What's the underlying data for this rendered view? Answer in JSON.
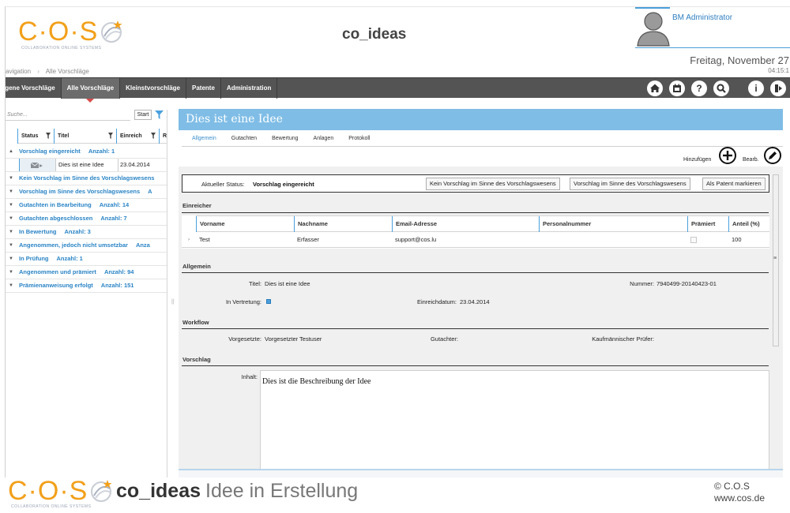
{
  "header": {
    "logo_text": "C·O·S",
    "logo_subtitle": "COLLABORATION ONLINE SYSTEMS",
    "app_title": "co_ideas",
    "user_name": "BM Administrator",
    "date": "Freitag, November 27",
    "time": "04:15:1",
    "breadcrumb": [
      "avigation",
      "Alle Vorschläge"
    ]
  },
  "nav": {
    "tabs": [
      {
        "label": "igene Vorschläge",
        "active": false
      },
      {
        "label": "Alle Vorschläge",
        "active": true
      },
      {
        "label": "Kleinstvorschläge",
        "active": false
      },
      {
        "label": "Patente",
        "active": false
      },
      {
        "label": "Administration",
        "active": false
      }
    ],
    "icons": [
      "home-icon",
      "calendar-icon",
      "help-icon",
      "search-icon",
      "info-icon",
      "logout-icon"
    ]
  },
  "left": {
    "search_placeholder": "Suche...",
    "start_label": "Start",
    "columns": [
      "Status",
      "Titel",
      "Einreich",
      "R"
    ],
    "groups": [
      {
        "label": "Vorschlag eingereicht",
        "count_label": "Anzahl: 1",
        "expanded": true,
        "items": [
          {
            "title": "Dies ist eine Idee",
            "date": "23.04.2014"
          }
        ]
      },
      {
        "label": "Kein Vorschlag im Sinne des Vorschlagswesens",
        "count_label": "",
        "expanded": false,
        "items": []
      },
      {
        "label": "Vorschlag im Sinne des Vorschlagswesens",
        "count_label": "A",
        "expanded": false,
        "items": []
      },
      {
        "label": "Gutachten in Bearbeitung",
        "count_label": "Anzahl: 14",
        "expanded": false,
        "items": []
      },
      {
        "label": "Gutachten abgeschlossen",
        "count_label": "Anzahl: 7",
        "expanded": false,
        "items": []
      },
      {
        "label": "In Bewertung",
        "count_label": "Anzahl: 3",
        "expanded": false,
        "items": []
      },
      {
        "label": "Angenommen, jedoch nicht umsetzbar",
        "count_label": "Anza",
        "expanded": false,
        "items": []
      },
      {
        "label": "In Prüfung",
        "count_label": "Anzahl: 1",
        "expanded": false,
        "items": []
      },
      {
        "label": "Angenommen und prämiert",
        "count_label": "Anzahl: 94",
        "expanded": false,
        "items": []
      },
      {
        "label": "Prämienanweisung erfolgt",
        "count_label": "Anzahl: 151",
        "expanded": false,
        "items": []
      }
    ]
  },
  "detail": {
    "title": "Dies ist eine Idee",
    "tabs": [
      {
        "label": "Allgemein",
        "active": true
      },
      {
        "label": "Gutachten",
        "active": false
      },
      {
        "label": "Bewertung",
        "active": false
      },
      {
        "label": "Anlagen",
        "active": false
      },
      {
        "label": "Protokoll",
        "active": false
      }
    ],
    "add_label": "Hinzufügen",
    "edit_label": "Bearb.",
    "status_label": "Aktueller Status:",
    "status_value": "Vorschlag eingereicht",
    "status_buttons": [
      "Kein Vorschlag im Sinne des Vorschlagswesens",
      "Vorschlag im Sinne des Vorschlagswesens",
      "Als Patent markieren"
    ],
    "einreicher": {
      "section": "Einreicher",
      "columns": [
        "Vorname",
        "Nachname",
        "Email-Adresse",
        "Personalnummer",
        "Prämiert",
        "Anteil (%)"
      ],
      "rows": [
        {
          "vorname": "Test",
          "nachname": "Erfasser",
          "email": "support@cos.lu",
          "personalnummer": "",
          "praemiert": false,
          "anteil": "100"
        }
      ]
    },
    "allgemein": {
      "section": "Allgemein",
      "titel_label": "Titel:",
      "titel_value": "Dies ist eine Idee",
      "nummer_label": "Nummer:",
      "nummer_value": "7940499-20140423-01",
      "vertretung_label": "In Vertretung:",
      "einreichdatum_label": "Einreichdatum:",
      "einreichdatum_value": "23.04.2014"
    },
    "workflow": {
      "section": "Workflow",
      "vorgesetzte_label": "Vorgesetzte:",
      "vorgesetzte_value": "Vorgesetzter Testuser",
      "gutachter_label": "Gutachter:",
      "gutachter_value": "",
      "pruefer_label": "Kaufmännischer Prüfer:",
      "pruefer_value": ""
    },
    "vorschlag": {
      "section": "Vorschlag",
      "inhalt_label": "Inhalt:",
      "inhalt_value": "Dies ist die Beschreibung der Idee"
    }
  },
  "footer": {
    "brand": "co_ideas",
    "subtitle": "Idee in Erstellung",
    "copyright": "© C.O.S",
    "website": "www.cos.de"
  },
  "colors": {
    "brand_orange": "#f2a01a",
    "accent_blue": "#7fbde6",
    "link_blue": "#2a84c6",
    "navbar": "#545454"
  }
}
